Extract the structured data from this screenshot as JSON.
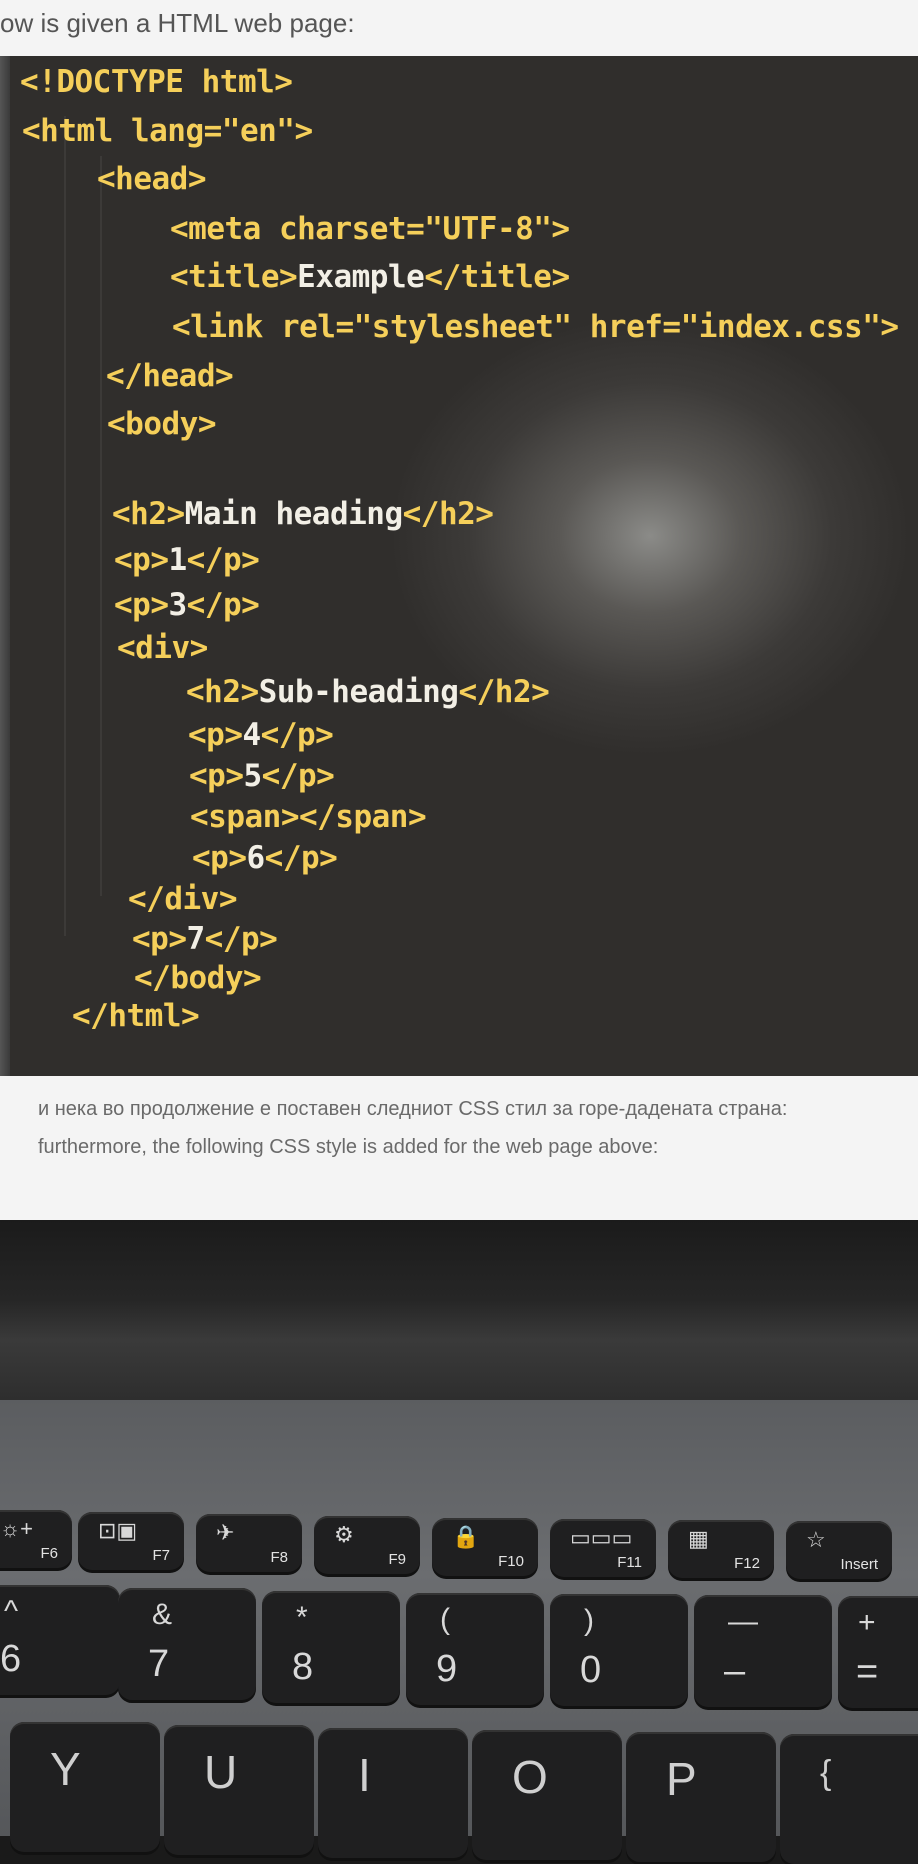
{
  "intro_text": "ow is given a HTML web page:",
  "code_lines": [
    {
      "tag1": "<!DOCTYPE html>",
      "text": "",
      "tag2": ""
    },
    {
      "tag1": "<html lang=\"en\">",
      "text": "",
      "tag2": ""
    },
    {
      "tag1": "<head>",
      "text": "",
      "tag2": ""
    },
    {
      "tag1": "<meta charset=\"UTF-8\">",
      "text": "",
      "tag2": ""
    },
    {
      "tag1": "<title>",
      "text": "Example",
      "tag2": "</title>"
    },
    {
      "tag1": "<link rel=\"stylesheet\" href=\"index.css\">",
      "text": "",
      "tag2": ""
    },
    {
      "tag1": "</head>",
      "text": "",
      "tag2": ""
    },
    {
      "tag1": "<body>",
      "text": "",
      "tag2": ""
    },
    {
      "tag1": "<h2>",
      "text": "Main heading",
      "tag2": "</h2>"
    },
    {
      "tag1": "<p>",
      "text": "1",
      "tag2": "</p>"
    },
    {
      "tag1": "<p>",
      "text": "3",
      "tag2": "</p>"
    },
    {
      "tag1": "<div>",
      "text": "",
      "tag2": ""
    },
    {
      "tag1": "<h2>",
      "text": "Sub-heading",
      "tag2": "</h2>"
    },
    {
      "tag1": "<p>",
      "text": "4",
      "tag2": "</p>"
    },
    {
      "tag1": "<p>",
      "text": "5",
      "tag2": "</p>"
    },
    {
      "tag1": "<span></span>",
      "text": "",
      "tag2": ""
    },
    {
      "tag1": "<p>",
      "text": "6",
      "tag2": "</p>"
    },
    {
      "tag1": "</div>",
      "text": "",
      "tag2": ""
    },
    {
      "tag1": "<p>",
      "text": "7",
      "tag2": "</p>"
    },
    {
      "tag1": "</body>",
      "text": "",
      "tag2": ""
    },
    {
      "tag1": "</html>",
      "text": "",
      "tag2": ""
    }
  ],
  "paragraph_mk": "и нека во продолжение е поставен следниот CSS стил за горе-дадената страна:",
  "paragraph_en": "furthermore, the following CSS style is added for the web page above:",
  "function_keys": [
    {
      "icon": "☼+",
      "label": "F6"
    },
    {
      "icon": "⊡▣",
      "label": "F7"
    },
    {
      "icon": "✈",
      "label": "F8"
    },
    {
      "icon": "⚙",
      "label": "F9"
    },
    {
      "icon": "🔒",
      "label": "F10"
    },
    {
      "icon": "▭▭▭",
      "label": "F11"
    },
    {
      "icon": "▦",
      "label": "F12"
    },
    {
      "icon": "☆",
      "label": "Insert"
    }
  ],
  "number_keys": [
    {
      "top": "^",
      "bottom": "6"
    },
    {
      "top": "&",
      "bottom": "7"
    },
    {
      "top": "*",
      "bottom": "8"
    },
    {
      "top": "(",
      "bottom": "9"
    },
    {
      "top": ")",
      "bottom": "0"
    },
    {
      "top": "—",
      "bottom": "–"
    },
    {
      "top": "+",
      "bottom": "="
    }
  ],
  "letter_keys": [
    {
      "top": "Y"
    },
    {
      "top": "U"
    },
    {
      "top": "I"
    },
    {
      "top": "O"
    },
    {
      "top": "P"
    },
    {
      "top": "{"
    }
  ]
}
